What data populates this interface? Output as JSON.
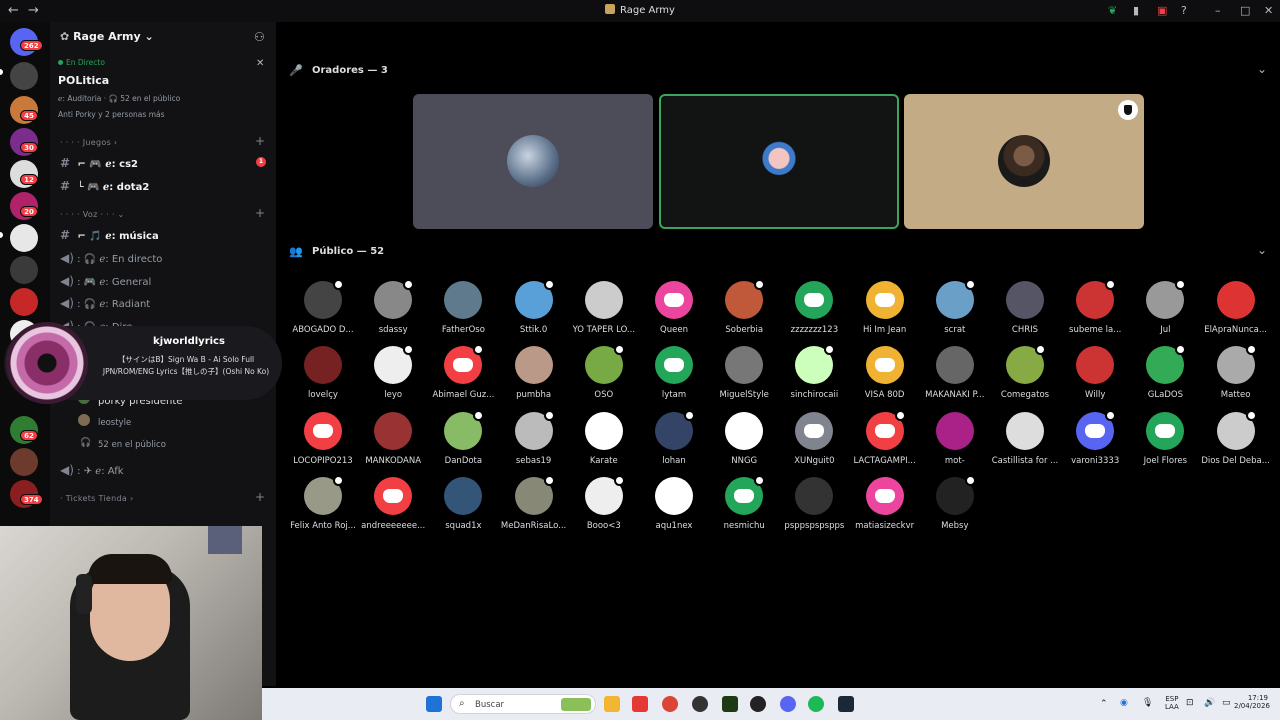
{
  "window": {
    "title": "Rage Army"
  },
  "rail": {
    "home_badge": "262",
    "badges": [
      "45",
      "30",
      "12",
      "20",
      "62",
      "374"
    ]
  },
  "sidebar": {
    "server_name": "Rage Army",
    "live_label": "En Directo",
    "stage_title": "POLitica",
    "stage_info": "ℯ: Auditoria · 🎧 52 en el público",
    "stage_people": "Anti Porky y 2 personas más",
    "categories": [
      "Juegos",
      "Voz",
      "Tickets Tienda"
    ],
    "channels": [
      {
        "prefix": "ℯ:",
        "name": "cs2",
        "unread": "1",
        "active": true
      },
      {
        "prefix": "ℯ:",
        "name": "dota2",
        "active": true
      },
      {
        "prefix": "ℯ:",
        "name": "música",
        "active": true
      },
      {
        "prefix": "ℯ:",
        "name": "En directo"
      },
      {
        "prefix": "ℯ:",
        "name": "General"
      },
      {
        "prefix": "ℯ:",
        "name": "Radiant"
      },
      {
        "prefix": "ℯ:",
        "name": "Dire"
      }
    ],
    "stage_members": [
      "porky presidente",
      "leostyle"
    ],
    "stage_audience": "52 en el público",
    "afk_channel": "ℯ: Afk"
  },
  "now_playing": {
    "channel": "kjworldlyrics",
    "title": "【サインはB】Sign Wa B - Ai Solo Full JPN/ROM/ENG Lyrics【推しの子】(Oshi No Ko)"
  },
  "main": {
    "speakers_label": "Oradores — 3",
    "audience_label": "Público — 52",
    "audience": [
      [
        "ABOGADO D...",
        "sdassy",
        "FatherOso",
        "Sttik.0",
        "YO TAPER LO...",
        "Queen",
        "Soberbia",
        "zzzzzzz123",
        "Hi Im Jean",
        "scrat",
        "CHRIS",
        "subeme la...",
        "Jul",
        "ElApraNunca..."
      ],
      [
        "lovelçy",
        "leyo",
        "Abimael Guz...",
        "pumbha",
        "OSO",
        "lytam",
        "MiguelStyle",
        "sinchirocaii",
        "VISA 80D",
        "MAKANAKI P...",
        "Comegatos",
        "Willy",
        "GLaDOS",
        "Matteo"
      ],
      [
        "LOCOPIPO213",
        "MANKODANA",
        "DanDota",
        "sebas19",
        "Karate",
        "lohan",
        "NNGG",
        "XUNguit0",
        "LACTAGAMPI...",
        "mot-",
        "Castillista for ...",
        "varoni3333",
        "Joel Flores",
        "Dios Del Deba..."
      ],
      [
        "Felix Anto Roj...",
        "andreeeeeee...",
        "squad1x",
        "MeDanRisaLo...",
        "Booo<3",
        "aqu1nex",
        "nesmichu",
        "psppspspspps",
        "matiasizeckvr",
        "Mebsy"
      ]
    ]
  },
  "taskbar": {
    "search_placeholder": "Buscar",
    "lang": "ESP",
    "lang2": "LAA",
    "time": "17:19",
    "date": "2/04/2026"
  }
}
